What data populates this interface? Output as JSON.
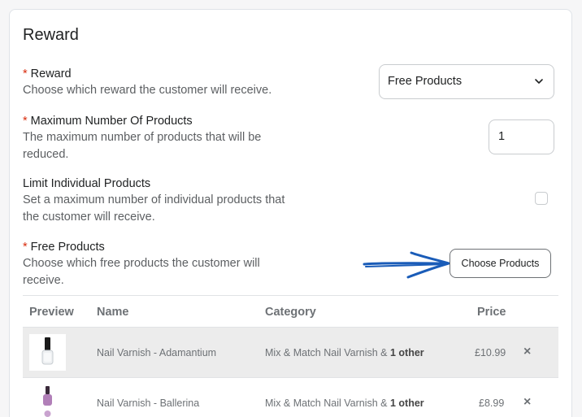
{
  "card": {
    "title": "Reward"
  },
  "reward_field": {
    "required_mark": "*",
    "label": "Reward",
    "help": "Choose which reward the customer will receive.",
    "value": "Free Products"
  },
  "max_products_field": {
    "required_mark": "*",
    "label": "Maximum Number Of Products",
    "help": "The maximum number of products that will be reduced.",
    "value": "1"
  },
  "limit_field": {
    "label": "Limit Individual Products",
    "help": "Set a maximum number of individual products that the customer will receive.",
    "checked": false
  },
  "free_products_field": {
    "required_mark": "*",
    "label": "Free Products",
    "help": "Choose which free products the customer will receive.",
    "button_label": "Choose Products"
  },
  "annotation": {
    "color": "#1a5cb8"
  },
  "table": {
    "headers": [
      "Preview",
      "Name",
      "Category",
      "Price"
    ],
    "rows": [
      {
        "name": "Nail Varnish - Adamantium",
        "category": "Mix & Match Nail Varnish &",
        "category_extra": "1 other",
        "price": "£10.99",
        "thumb": "clear-nail-varnish-bottle",
        "remove": "×"
      },
      {
        "name": "Nail Varnish - Ballerina",
        "category": "Mix & Match Nail Varnish &",
        "category_extra": "1 other",
        "price": "£8.99",
        "thumb": "pink-nail-varnish-bottle",
        "remove": "×"
      }
    ]
  },
  "colors": {
    "required": "#d82c0d",
    "border": "#c9cccf",
    "highlight_row": "#ececec"
  }
}
